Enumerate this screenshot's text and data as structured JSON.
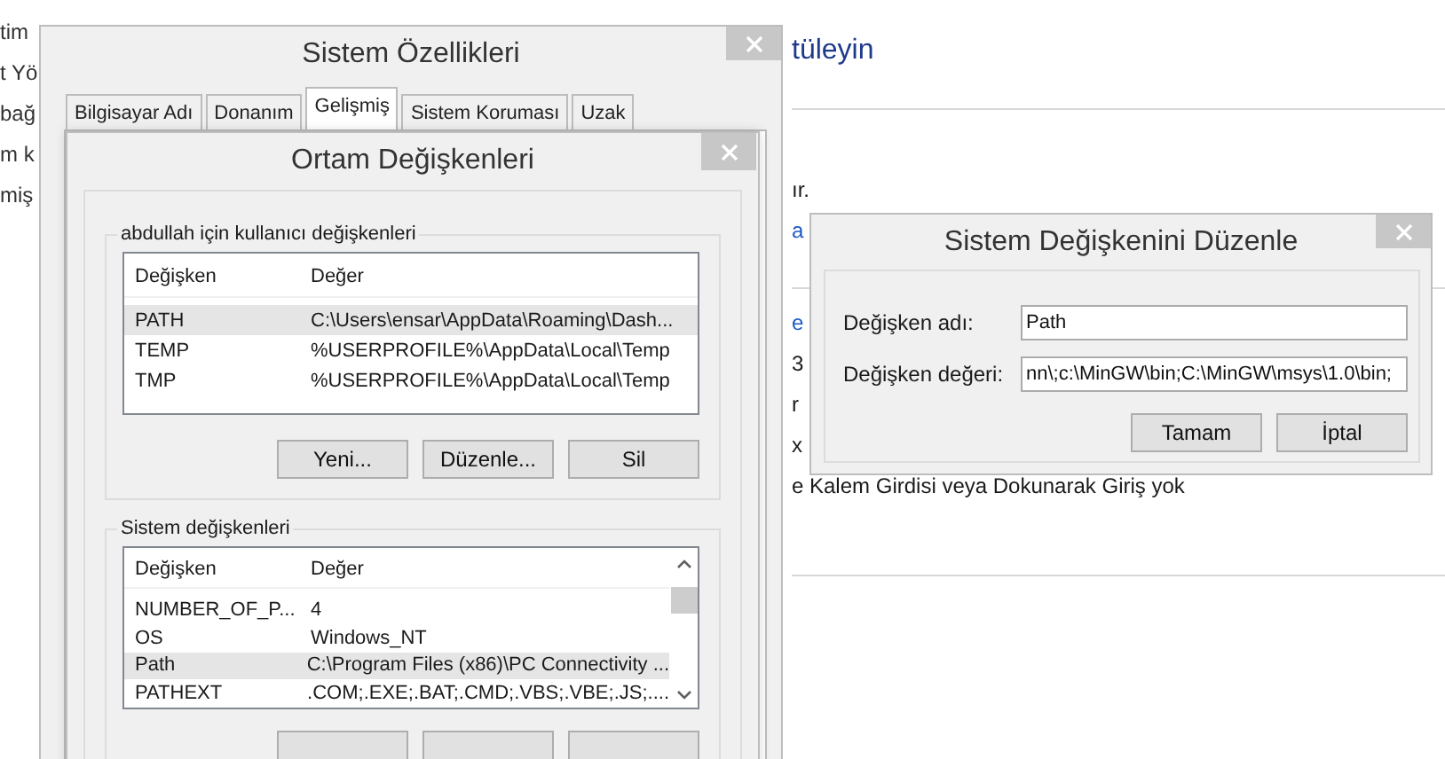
{
  "background": {
    "left_fragments": [
      "tim",
      "t Yö",
      "bağ",
      "m k",
      "miş"
    ],
    "heading": "tüleyin",
    "right_fragments": [
      {
        "text": "ır.",
        "kind": "text"
      },
      {
        "text": "a",
        "kind": "link"
      },
      {
        "text": "e",
        "kind": "link"
      },
      {
        "text": "3",
        "kind": "text"
      },
      {
        "text": "r",
        "kind": "text"
      },
      {
        "text": "x",
        "kind": "text"
      },
      {
        "text": "e Kalem Girdisi veya Dokunarak Giriş yok",
        "kind": "text"
      }
    ]
  },
  "system_properties": {
    "title": "Sistem Özellikleri",
    "tabs": [
      {
        "label": "Bilgisayar Adı",
        "selected": false
      },
      {
        "label": "Donanım",
        "selected": false
      },
      {
        "label": "Gelişmiş",
        "selected": true
      },
      {
        "label": "Sistem Koruması",
        "selected": false
      },
      {
        "label": "Uzak",
        "selected": false
      }
    ]
  },
  "environment_variables": {
    "title": "Ortam Değişkenleri",
    "user_variables": {
      "label": "abdullah için kullanıcı değişkenleri",
      "columns": [
        "Değişken",
        "Değer"
      ],
      "rows": [
        {
          "name": "PATH",
          "value": "C:\\Users\\ensar\\AppData\\Roaming\\Dash...",
          "selected": true
        },
        {
          "name": "TEMP",
          "value": "%USERPROFILE%\\AppData\\Local\\Temp",
          "selected": false
        },
        {
          "name": "TMP",
          "value": "%USERPROFILE%\\AppData\\Local\\Temp",
          "selected": false
        }
      ],
      "buttons": [
        "Yeni...",
        "Düzenle...",
        "Sil"
      ]
    },
    "system_variables": {
      "label": "Sistem değişkenleri",
      "columns": [
        "Değişken",
        "Değer"
      ],
      "rows": [
        {
          "name": "NUMBER_OF_P...",
          "value": "4",
          "selected": false
        },
        {
          "name": "OS",
          "value": "Windows_NT",
          "selected": false
        },
        {
          "name": "Path",
          "value": "C:\\Program Files (x86)\\PC Connectivity ...",
          "selected": true
        },
        {
          "name": "PATHEXT",
          "value": ".COM;.EXE;.BAT;.CMD;.VBS;.VBE;.JS;....",
          "selected": false
        }
      ]
    }
  },
  "edit_dialog": {
    "title": "Sistem Değişkenini Düzenle",
    "fields": [
      {
        "label": "Değişken adı:",
        "value": "Path"
      },
      {
        "label": "Değişken değeri:",
        "value": "nn\\;c:\\MinGW\\bin;C:\\MinGW\\msys\\1.0\\bin;"
      }
    ],
    "buttons": [
      "Tamam",
      "İptal"
    ]
  }
}
